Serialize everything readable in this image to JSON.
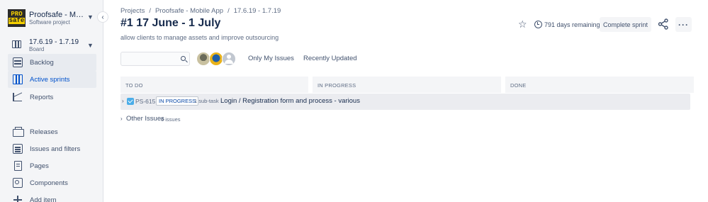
{
  "sidebar": {
    "project": {
      "logo_top": "PRO",
      "logo_bottom": "safe",
      "name": "Proofsafe - Mobile App",
      "type": "Software project"
    },
    "board": {
      "name": "17.6.19 - 1.7.19",
      "type": "Board"
    },
    "items": [
      {
        "label": "Backlog",
        "icon": "backlog-icon"
      },
      {
        "label": "Active sprints",
        "icon": "board-icon"
      },
      {
        "label": "Reports",
        "icon": "reports-icon"
      },
      {
        "label": "Releases",
        "icon": "releases-icon"
      },
      {
        "label": "Issues and filters",
        "icon": "issues-icon"
      },
      {
        "label": "Pages",
        "icon": "pages-icon"
      },
      {
        "label": "Components",
        "icon": "components-icon"
      },
      {
        "label": "Add item",
        "icon": "add-icon"
      }
    ]
  },
  "breadcrumbs": [
    "Projects",
    "Proofsafe - Mobile App",
    "17.6.19 - 1.7.19"
  ],
  "sprint": {
    "title": "#1 17 June - 1 July",
    "goal": "allow clients to manage assets and improve outsourcing",
    "days_remaining": "791 days remaining",
    "complete_label": "Complete sprint"
  },
  "filters": {
    "search_placeholder": "",
    "only_my_issues": "Only My Issues",
    "recently_updated": "Recently Updated"
  },
  "columns": [
    "TO DO",
    "IN PROGRESS",
    "DONE"
  ],
  "swimlane": {
    "key": "PS-615",
    "status": "IN PROGRESS",
    "subtasks": "1 sub-task",
    "summary": "Login / Registration form and process - various"
  },
  "other_issues": {
    "label": "Other Issues",
    "count": "6 issues"
  },
  "colors": {
    "accent": "#0052cc",
    "sidebar_bg": "#f4f5f7",
    "checkbox": "#4bade8"
  }
}
